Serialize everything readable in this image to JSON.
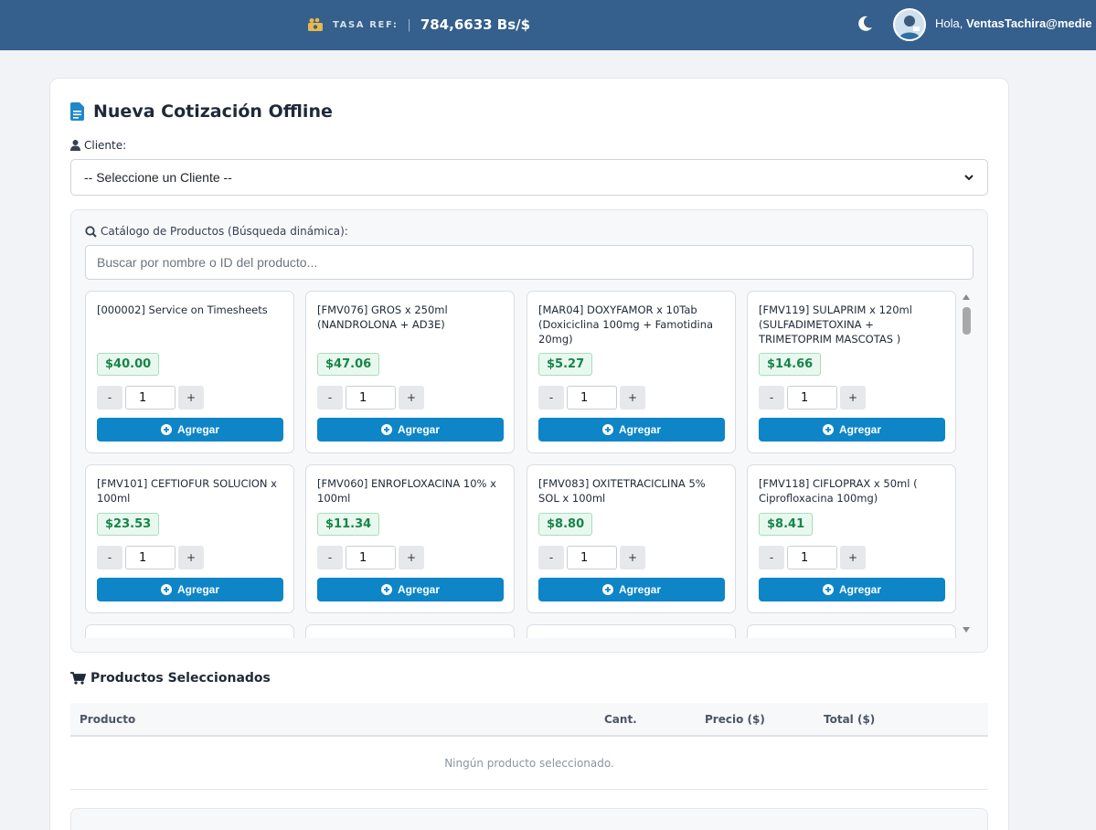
{
  "header": {
    "rate_label": "TASA REF:",
    "rate_separator": "|",
    "rate_value": "784,6633 Bs/$",
    "greeting_prefix": "Hola,",
    "username": "VentasTachira@medie",
    "icons": {
      "rate": "money-coins-icon",
      "theme": "moon-icon",
      "user": "avatar"
    }
  },
  "page": {
    "title": "Nueva Cotización Offline",
    "client_label": "Cliente:",
    "client_select_value": "-- Seleccione un Cliente --"
  },
  "catalog": {
    "label": "Catálogo de Productos (Búsqueda dinámica):",
    "search_placeholder": "Buscar por nombre o ID del producto...",
    "add_label": "Agregar",
    "minus_label": "-",
    "plus_label": "+",
    "products": [
      {
        "name": "[000002] Service on Timesheets",
        "price": "$40.00",
        "qty": "1"
      },
      {
        "name": "[FMV076] GROS x 250ml (NANDROLONA + AD3E)",
        "price": "$47.06",
        "qty": "1"
      },
      {
        "name": "[MAR04] DOXYFAMOR x 10Tab (Doxiciclina 100mg + Famotidina 20mg)",
        "price": "$5.27",
        "qty": "1"
      },
      {
        "name": "[FMV119] SULAPRIM x 120ml (SULFADIMETOXINA + TRIMETOPRIM MASCOTAS )",
        "price": "$14.66",
        "qty": "1"
      },
      {
        "name": "[FMV101] CEFTIOFUR SOLUCION x 100ml",
        "price": "$23.53",
        "qty": "1"
      },
      {
        "name": "[FMV060] ENROFLOXACINA 10% x 100ml",
        "price": "$11.34",
        "qty": "1"
      },
      {
        "name": "[FMV083] OXITETRACICLINA 5% SOL x 100ml",
        "price": "$8.80",
        "qty": "1"
      },
      {
        "name": "[FMV118] CIFLOPRAX x 50ml ( Ciprofloxacina 100mg)",
        "price": "$8.41",
        "qty": "1"
      }
    ]
  },
  "selected": {
    "title": "Productos Seleccionados",
    "columns": [
      "Producto",
      "Cant.",
      "Precio ($)",
      "Total ($)"
    ],
    "empty_text": "Ningún producto seleccionado."
  },
  "colors": {
    "topbar": "#355f8c",
    "primary_button": "#0d85c7",
    "price_text": "#16854a",
    "price_bg": "#e9f8ef"
  }
}
